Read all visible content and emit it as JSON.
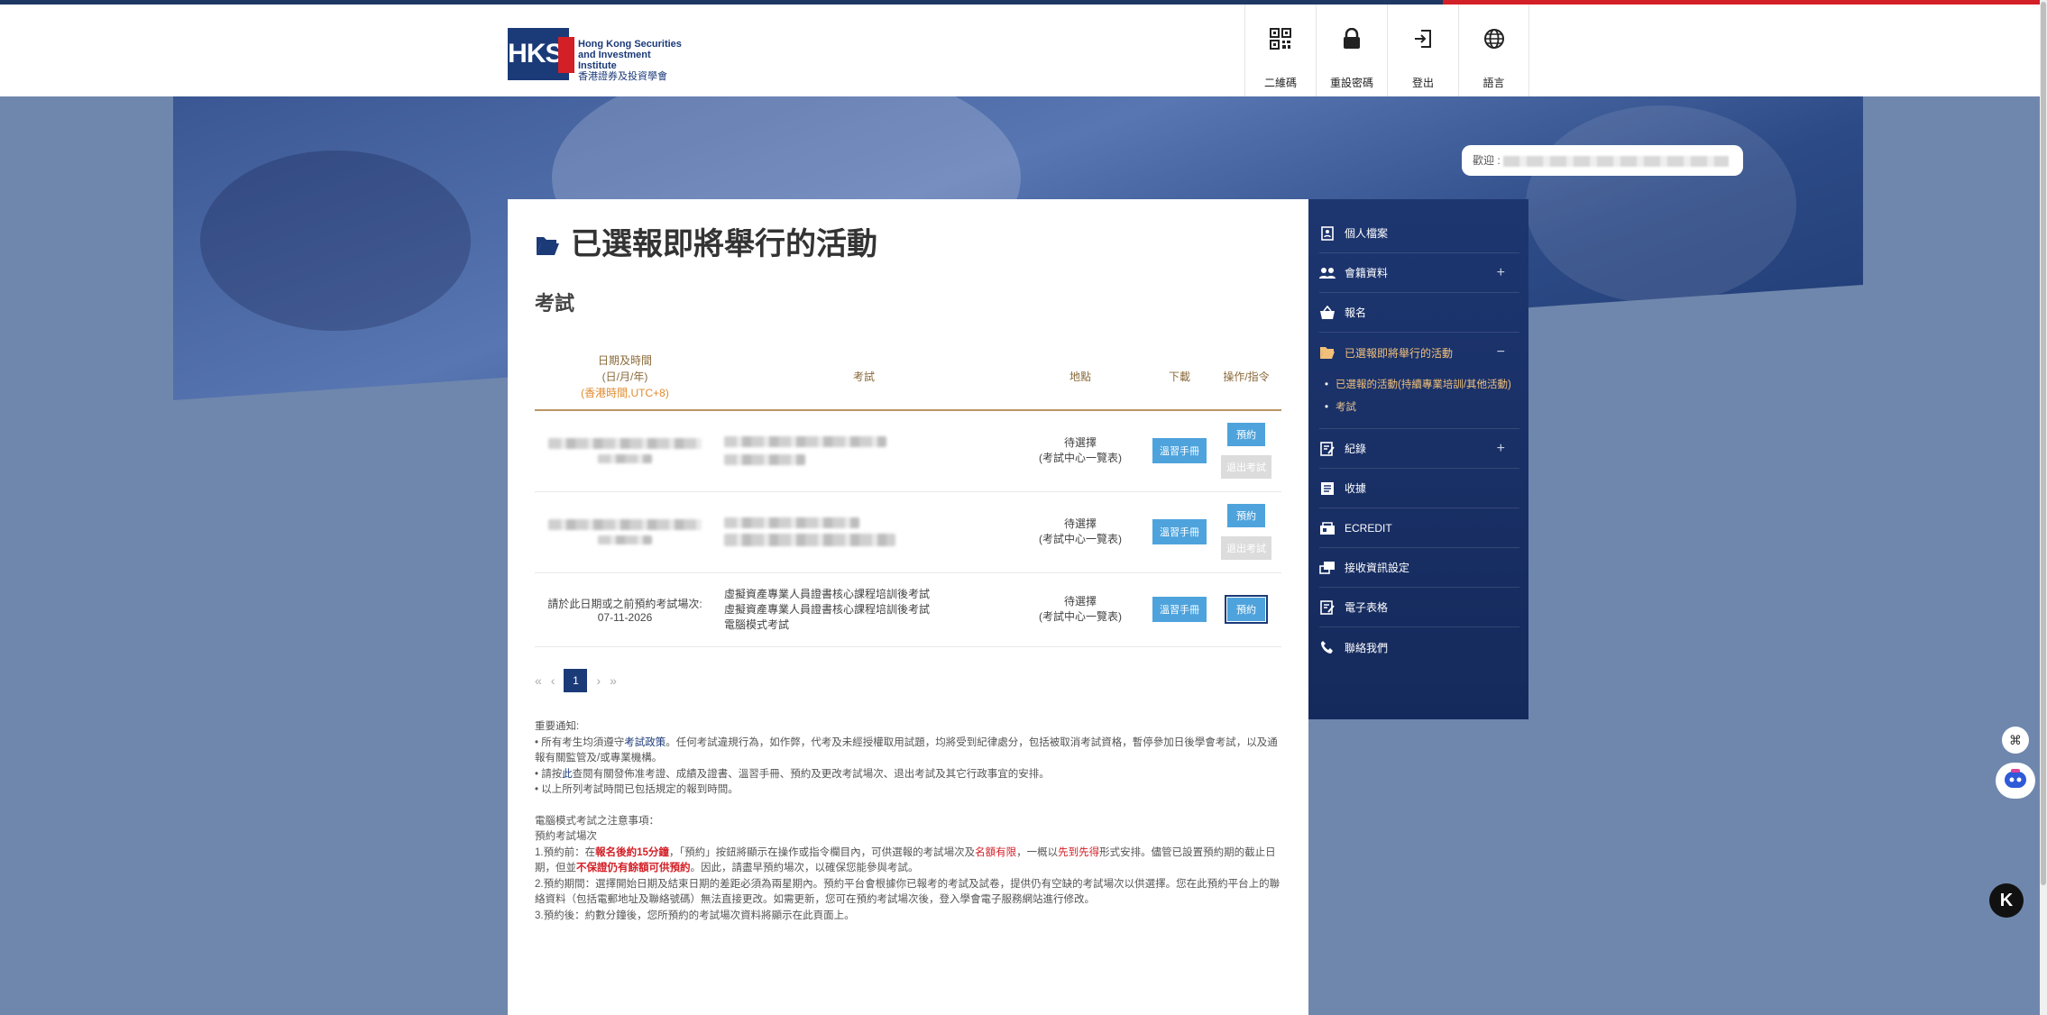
{
  "brand": {
    "logo_mark": "HKSI",
    "name_en_1": "Hong Kong Securities",
    "name_en_2": "and Investment Institute",
    "name_cn": "香港證券及投資學會"
  },
  "nav": [
    {
      "label": "二維碼",
      "icon": "qr-code-icon"
    },
    {
      "label": "重設密碼",
      "icon": "lock-icon"
    },
    {
      "label": "登出",
      "icon": "logout-icon"
    },
    {
      "label": "語言",
      "icon": "globe-icon"
    }
  ],
  "welcome": {
    "prefix": "歡迎 : "
  },
  "page": {
    "title": "已選報即將舉行的活動",
    "section": "考試"
  },
  "table": {
    "headers": {
      "date_1": "日期及時間",
      "date_2": "(日/月/年)",
      "date_3": "(香港時間,UTC+8)",
      "exam": "考試",
      "location": "地點",
      "download": "下載",
      "action": "操作/指令"
    },
    "rows": [
      {
        "location_1": "待選擇",
        "location_2": "(考試中心一覽表)",
        "download": "溫習手冊",
        "book": "預約",
        "withdraw": "退出考試"
      },
      {
        "location_1": "待選擇",
        "location_2": "(考試中心一覽表)",
        "download": "溫習手冊",
        "book": "預約",
        "withdraw": "退出考試"
      },
      {
        "date_note": "請於此日期或之前預約考試場次:",
        "date_value": "07-11-2026",
        "exam_1": "虛擬資產專業人員證書核心課程培訓後考試",
        "exam_2": "虛擬資產專業人員證書核心課程培訓後考試",
        "exam_3": "電腦模式考試",
        "location_1": "待選擇",
        "location_2": "(考試中心一覽表)",
        "download": "溫習手冊",
        "book": "預約"
      }
    ]
  },
  "pager": {
    "first": "«",
    "prev": "‹",
    "current": "1",
    "next": "›",
    "last": "»"
  },
  "notes": {
    "heading": "重要通知:",
    "b1_a": "• 所有考生均須遵守",
    "b1_link": "考試政策",
    "b1_b": "。任何考試違規行為，如作弊，代考及未經授權取用試題，均將受到紀律處分，包括被取消考試資格，暫停參加日後學會考試，以及通報有關監管及/或專業機構。",
    "b2_a": "• 請按",
    "b2_link": "此",
    "b2_b": "查閱有關發佈准考證、成績及證書、溫習手冊、預約及更改考試場次、退出考試及其它行政事宜的安排。",
    "b3": "• 以上所列考試時間已包括規定的報到時間。",
    "cb_heading": "電腦模式考試之注意事項：",
    "cb_sub": "預約考試場次",
    "p1_a": "1.預約前：在",
    "p1_red1": "報名後約15分鐘",
    "p1_b": "，「預約」按鈕將顯示在操作或指令欄目內，可供選報的考試場次及",
    "p1_red2": "名額有限",
    "p1_c": "，一概以",
    "p1_red3": "先到先得",
    "p1_d": "形式安排。儘管已設置預約期的截止日期，但並",
    "p1_red4": "不保證仍有餘額可供預約",
    "p1_e": "。因此，請盡早預約場次，以確保您能參與考試。",
    "p2": "2.預約期間：選擇開始日期及結束日期的差距必須為兩星期內。預約平台會根據你已報考的考試及試卷，提供仍有空缺的考試場次以供選擇。您在此預約平台上的聯絡資料（包括電郵地址及聯絡號碼）無法直接更改。如需更新，您可在預約考試場次後，登入學會電子服務網站進行修改。",
    "p3": "3.預約後：約數分鐘後，您所預約的考試場次資料將顯示在此頁面上。"
  },
  "sidebar": {
    "items": [
      {
        "label": "個人檔案",
        "icon": "profile-icon"
      },
      {
        "label": "會籍資料",
        "icon": "members-icon",
        "expand": "+"
      },
      {
        "label": "報名",
        "icon": "basket-icon"
      },
      {
        "label": "已選報即將舉行的活動",
        "icon": "folder-open-icon",
        "expand": "−"
      },
      {
        "label": "紀錄",
        "icon": "record-icon",
        "expand": "+"
      },
      {
        "label": "收據",
        "icon": "receipt-icon"
      },
      {
        "label": "ECREDIT",
        "icon": "ecredit-icon"
      },
      {
        "label": "接收資訊設定",
        "icon": "settings-msg-icon"
      },
      {
        "label": "電子表格",
        "icon": "eform-icon"
      },
      {
        "label": "聯絡我們",
        "icon": "phone-icon"
      }
    ],
    "sub_items": [
      "已選報的活動(持續專業培訓/其他活動)",
      "考試"
    ]
  },
  "widgets": {
    "f1": "⌘",
    "f3": "K"
  },
  "colors": {
    "navy": "#1b3a78",
    "accent_red": "#d31f26",
    "button_blue": "#4ea3dc",
    "gold": "#f2c079"
  }
}
